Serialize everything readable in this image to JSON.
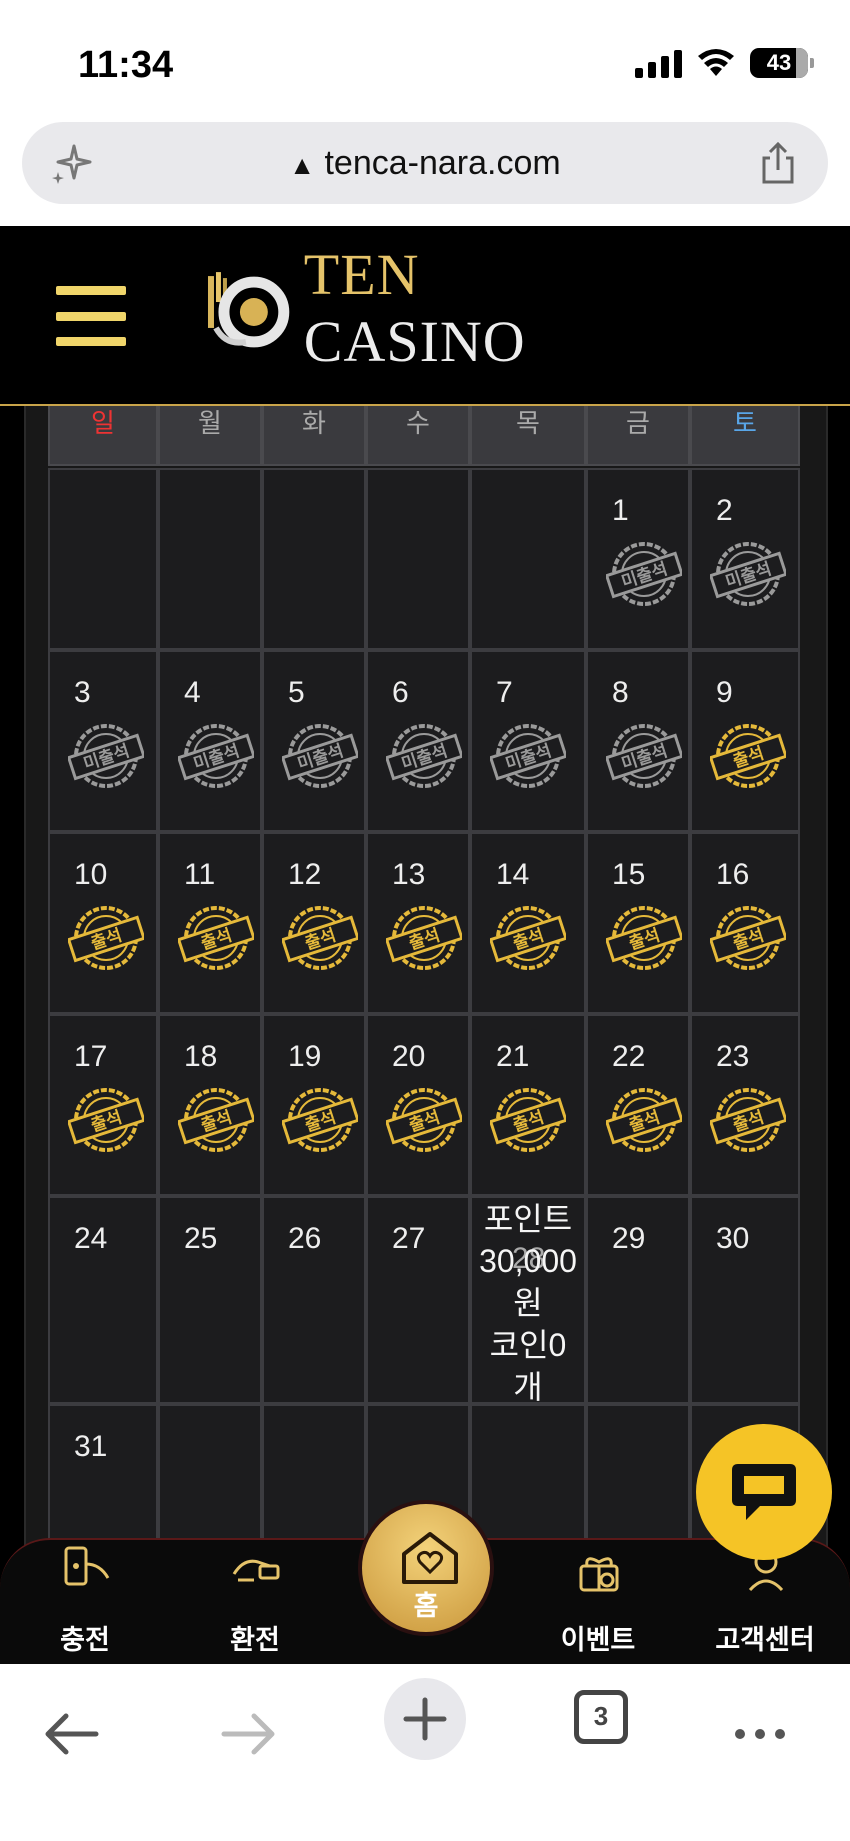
{
  "status_bar": {
    "time": "11:34",
    "battery": "43"
  },
  "browser": {
    "url": "tenca-nara.com",
    "tabs_count": "3"
  },
  "site": {
    "logo_ten": "TEN",
    "logo_casino": "CASINO"
  },
  "calendar": {
    "weekdays": [
      "일",
      "월",
      "화",
      "수",
      "목",
      "금",
      "토"
    ],
    "weeks": [
      [
        null,
        null,
        null,
        null,
        null,
        {
          "day": "1",
          "status": "absent"
        },
        {
          "day": "2",
          "status": "absent"
        }
      ],
      [
        {
          "day": "3",
          "status": "absent"
        },
        {
          "day": "4",
          "status": "absent"
        },
        {
          "day": "5",
          "status": "absent"
        },
        {
          "day": "6",
          "status": "absent"
        },
        {
          "day": "7",
          "status": "absent"
        },
        {
          "day": "8",
          "status": "absent"
        },
        {
          "day": "9",
          "status": "present"
        }
      ],
      [
        {
          "day": "10",
          "status": "present"
        },
        {
          "day": "11",
          "status": "present"
        },
        {
          "day": "12",
          "status": "present"
        },
        {
          "day": "13",
          "status": "present"
        },
        {
          "day": "14",
          "status": "present"
        },
        {
          "day": "15",
          "status": "present"
        },
        {
          "day": "16",
          "status": "present"
        }
      ],
      [
        {
          "day": "17",
          "status": "present"
        },
        {
          "day": "18",
          "status": "present"
        },
        {
          "day": "19",
          "status": "present"
        },
        {
          "day": "20",
          "status": "present"
        },
        {
          "day": "21",
          "status": "present"
        },
        {
          "day": "22",
          "status": "present"
        },
        {
          "day": "23",
          "status": "present"
        }
      ],
      [
        {
          "day": "24"
        },
        {
          "day": "25"
        },
        {
          "day": "26"
        },
        {
          "day": "27"
        },
        {
          "day": "28",
          "reward": [
            "포인트",
            "30,000",
            "원",
            "코인0",
            "개"
          ]
        },
        {
          "day": "29"
        },
        {
          "day": "30"
        }
      ],
      [
        {
          "day": "31"
        },
        null,
        null,
        null,
        null,
        null,
        null
      ]
    ],
    "stamp_absent": "미출석",
    "stamp_present": "출석"
  },
  "bottom_nav": {
    "deposit": "충전",
    "withdraw": "환전",
    "home": "홈",
    "event": "이벤트",
    "support": "고객센터"
  },
  "colors": {
    "gold": "#e5c36a",
    "chat": "#f5c426",
    "sunday": "#e33333",
    "saturday": "#59a6e8"
  }
}
